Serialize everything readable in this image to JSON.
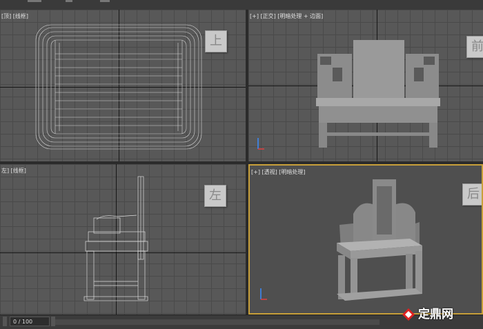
{
  "viewports": {
    "top": {
      "label": "[顶] [线框]",
      "cube_face": "上"
    },
    "front": {
      "label": "[+] [正交] [明暗处理 + 边面]",
      "cube_face": "前"
    },
    "left": {
      "label": "左] [线框]",
      "cube_face": "左"
    },
    "perspective": {
      "label": "[+] [透视] [明暗处理]",
      "cube_face": "后"
    }
  },
  "timeline": {
    "frame_counter": "0 / 100"
  },
  "watermark": {
    "text": "定鼎网"
  },
  "colors": {
    "active_border": "#c8a03a",
    "viewport_bg": "#585858",
    "persp_bg": "#4f4f4f"
  }
}
